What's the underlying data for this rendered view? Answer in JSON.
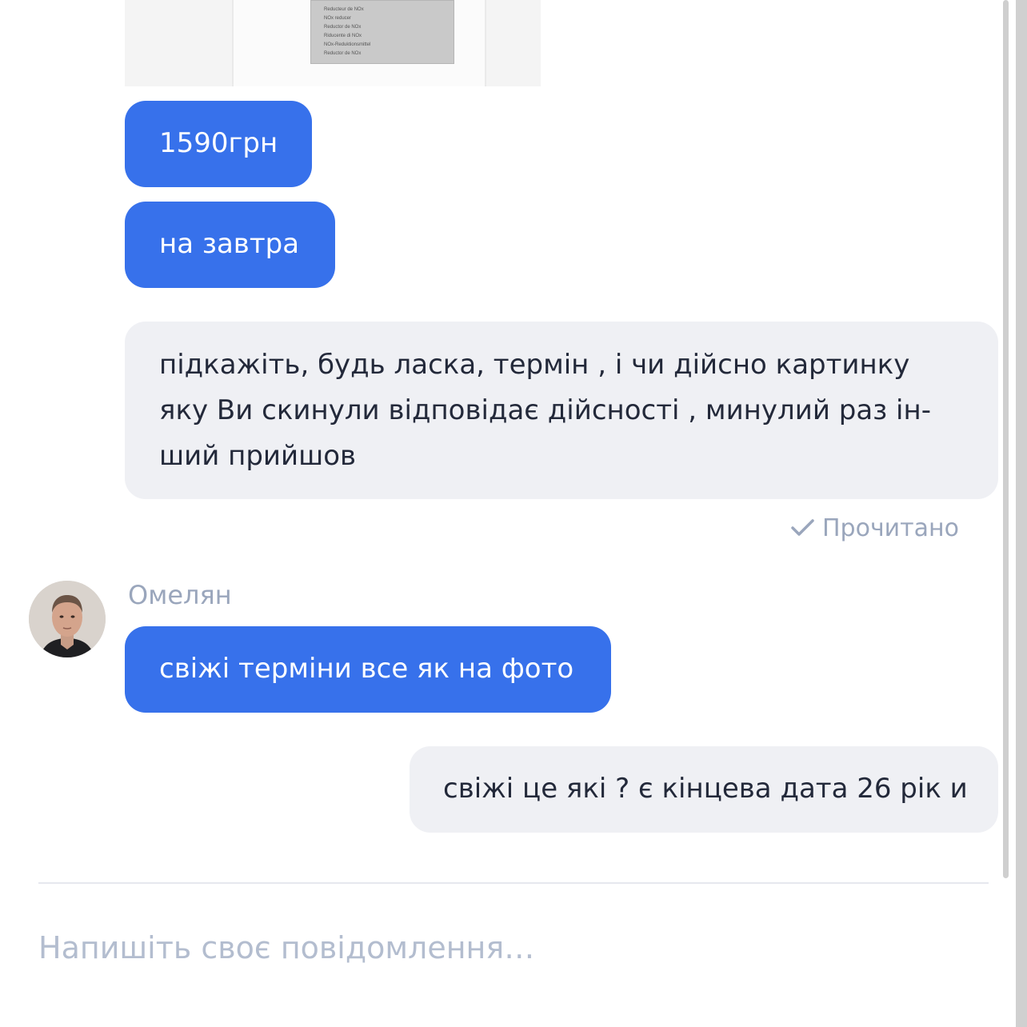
{
  "attachment": {
    "label_lines": [
      "Reducteur de NOx",
      "NOx reducer",
      "Reductor de NOx",
      "Riducente di NOx",
      "NOx-Reduktionsmittel",
      "Reductor de NOx"
    ]
  },
  "messages": {
    "price": "1590грн",
    "tomorrow": "на завтра",
    "question_lines": [
      "підкажіть, будь ласка, термін , і чи дійсно картинку",
      "яку Ви скинули відповідає дійсності , минулий раз ін-",
      "ший прийшов"
    ],
    "read_status": "Прочитано",
    "sender_name": "Омелян",
    "fresh_terms": "свіжі терміни все як на фото",
    "which_fresh": "свіжі це які ? є кінцева дата 26 рік и"
  },
  "composer": {
    "placeholder": "Напишіть своє повідомлення…"
  },
  "colors": {
    "outgoing_bubble": "#3771eb",
    "incoming_bubble": "#eff0f4",
    "muted_text": "#9aa6bc"
  }
}
